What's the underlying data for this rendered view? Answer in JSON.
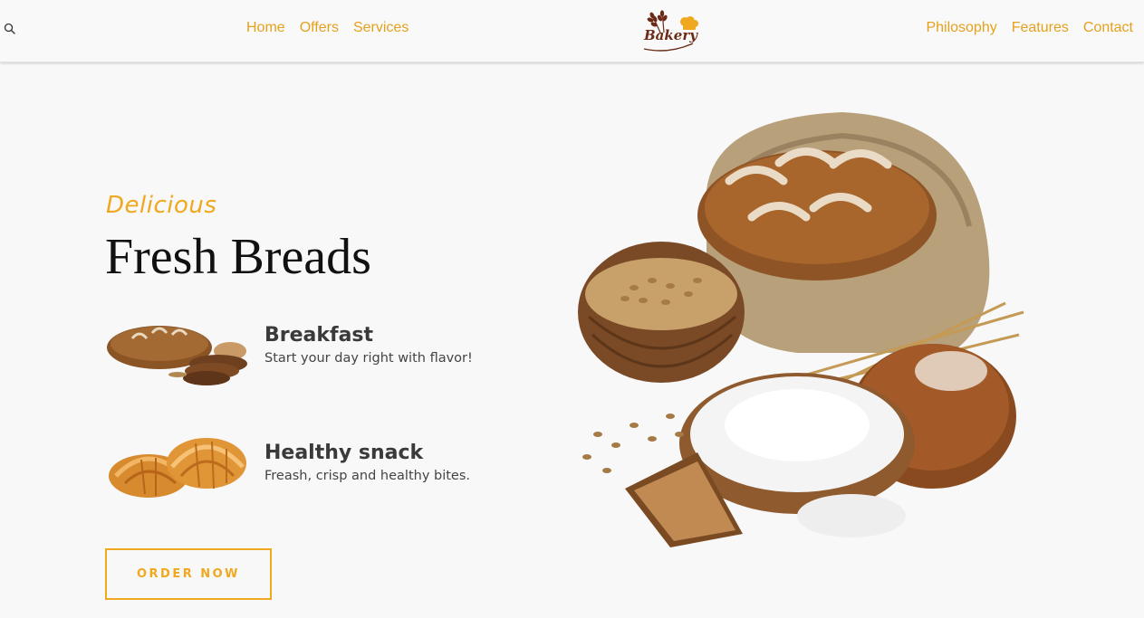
{
  "header": {
    "search_icon": "search-icon",
    "nav_left": [
      {
        "label": "Home"
      },
      {
        "label": "Offers"
      },
      {
        "label": "Services"
      }
    ],
    "logo_text": "Bakery",
    "nav_right": [
      {
        "label": "Philosophy"
      },
      {
        "label": "Features"
      },
      {
        "label": "Contact"
      }
    ]
  },
  "hero": {
    "eyebrow": "Delicious",
    "title": "Fresh Breads",
    "features": [
      {
        "title": "Breakfast",
        "description": "Start your day right with flavor!"
      },
      {
        "title": "Healthy snack",
        "description": "Freash, crisp and healthy bites."
      }
    ],
    "cta_label": "ORDER NOW"
  },
  "colors": {
    "accent": "#f0a81e",
    "nav_link": "#e4a11b",
    "heading": "#111111",
    "background": "#f8f8f8",
    "logo": "#6b2b16"
  }
}
